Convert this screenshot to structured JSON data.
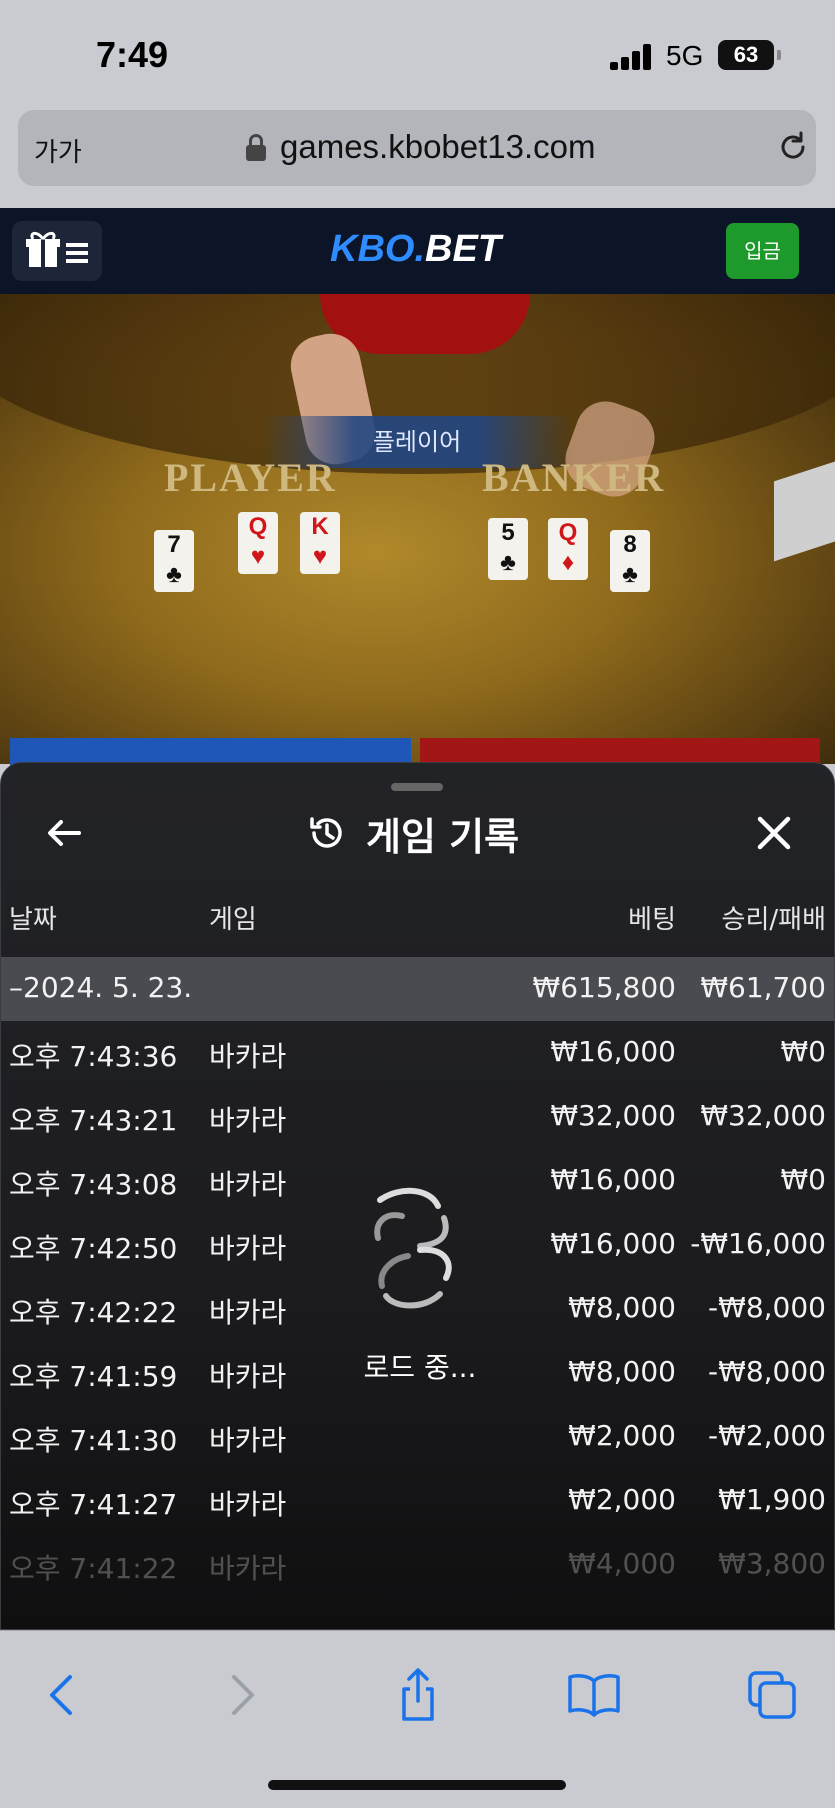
{
  "status_bar": {
    "time": "7:49",
    "network": "5G",
    "battery": "63"
  },
  "browser": {
    "text_size_label": "가가",
    "url": "games.kbobet13.com",
    "reload_icon": "reload-icon"
  },
  "site": {
    "logo_part1": "KBO.",
    "logo_part2": "BET",
    "deposit_label": "입금",
    "menu_icons": [
      "gift-icon",
      "hamburger-icon"
    ]
  },
  "video": {
    "result_label": "플레이어",
    "player_label": "PLAYER",
    "banker_label": "BANKER",
    "player_cards": [
      {
        "rank": "7",
        "suit": "♣",
        "color": "black"
      },
      {
        "rank": "Q",
        "suit": "♥",
        "color": "red"
      },
      {
        "rank": "K",
        "suit": "♥",
        "color": "red"
      }
    ],
    "banker_cards": [
      {
        "rank": "5",
        "suit": "♣",
        "color": "black"
      },
      {
        "rank": "Q",
        "suit": "♦",
        "color": "red"
      },
      {
        "rank": "8",
        "suit": "♣",
        "color": "black"
      }
    ]
  },
  "history": {
    "title": "게임 기록",
    "columns": {
      "date": "날짜",
      "game": "게임",
      "bet": "베팅",
      "result": "승리/패배"
    },
    "group": {
      "date": "–2024. 5. 23.",
      "bet": "₩615,800",
      "result": "₩61,700"
    },
    "rows": [
      {
        "time": "오후 7:43:36",
        "game": "바카라",
        "bet": "₩16,000",
        "result": "₩0"
      },
      {
        "time": "오후 7:43:21",
        "game": "바카라",
        "bet": "₩32,000",
        "result": "₩32,000"
      },
      {
        "time": "오후 7:43:08",
        "game": "바카라",
        "bet": "₩16,000",
        "result": "₩0"
      },
      {
        "time": "오후 7:42:50",
        "game": "바카라",
        "bet": "₩16,000",
        "result": "-₩16,000"
      },
      {
        "time": "오후 7:42:22",
        "game": "바카라",
        "bet": "₩8,000",
        "result": "-₩8,000"
      },
      {
        "time": "오후 7:41:59",
        "game": "바카라",
        "bet": "₩8,000",
        "result": "-₩8,000"
      },
      {
        "time": "오후 7:41:30",
        "game": "바카라",
        "bet": "₩2,000",
        "result": "-₩2,000"
      },
      {
        "time": "오후 7:41:27",
        "game": "바카라",
        "bet": "₩2,000",
        "result": "₩1,900"
      },
      {
        "time": "오후 7:41:22",
        "game": "바카라",
        "bet": "₩4,000",
        "result": "₩3,800"
      }
    ],
    "loading_text": "로드 중..."
  },
  "colors": {
    "accent_blue": "#2f8cff",
    "deposit_green": "#1e9a2c",
    "ios_blue": "#1a73e8"
  }
}
